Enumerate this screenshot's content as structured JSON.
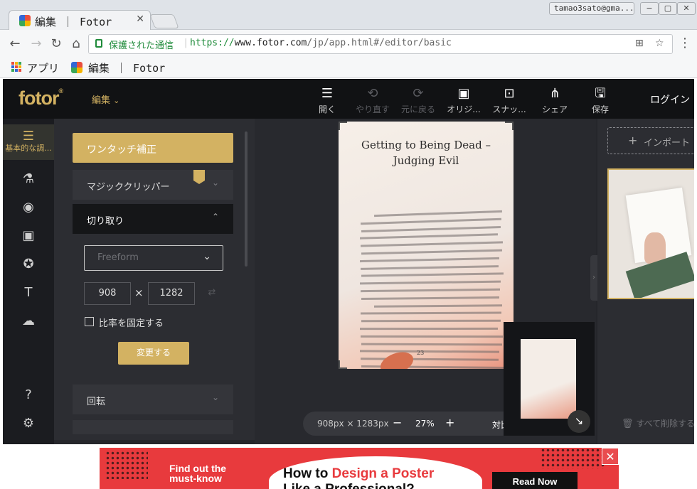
{
  "browser": {
    "tab_title": "編集 ｜ Fotor",
    "user": "tamao3sato@gma...",
    "secure_label": "保護された通信",
    "url_scheme": "https://",
    "url_host": "www.fotor.com",
    "url_path": "/jp/app.html#/editor/basic",
    "bookmarks": {
      "apps_label": "アプリ",
      "fotor_label": "編集 ｜ Fotor"
    }
  },
  "app": {
    "logo": "fotor",
    "edit_menu": "編集",
    "tools": [
      {
        "icon": "menu-icon",
        "label": "開く"
      },
      {
        "icon": "undo-icon",
        "label": "やり直す"
      },
      {
        "icon": "redo-icon",
        "label": "元に戻る"
      },
      {
        "icon": "image-icon",
        "label": "オリジ..."
      },
      {
        "icon": "snapshot-icon",
        "label": "スナッ..."
      },
      {
        "icon": "share-icon",
        "label": "シェア"
      },
      {
        "icon": "save-icon",
        "label": "保存"
      }
    ],
    "login": "ログイン",
    "sidebar": {
      "basic_label": "基本的な調..."
    },
    "panel": {
      "one_touch": "ワンタッチ補正",
      "magic_clipper": "マジッククリッパー",
      "crop": "切り取り",
      "ratio_select": "Freeform",
      "width": "908",
      "height": "1282",
      "times": "×",
      "lock_ratio": "比率を固定する",
      "apply": "変更する",
      "rotate": "回転"
    },
    "canvas": {
      "heading_line1": "Getting to Being Dead –",
      "heading_line2": "Judging Evil",
      "page_number": "23",
      "size": "908px × 1283px",
      "zoom": "27%",
      "compare": "対比"
    },
    "right": {
      "import": "インポート",
      "delete_all": "すべて削除する"
    }
  },
  "ad": {
    "left_line1": "Find out the",
    "left_line2": "must-know",
    "title_prefix": "How to ",
    "title_highlight": "Design a Poster",
    "title_line2": "Like a Professional?",
    "cta": "Read Now"
  },
  "colors": {
    "accent": "#d3b262",
    "header": "#111214",
    "panel": "#2c2d32",
    "ad": "#e83a3d"
  }
}
